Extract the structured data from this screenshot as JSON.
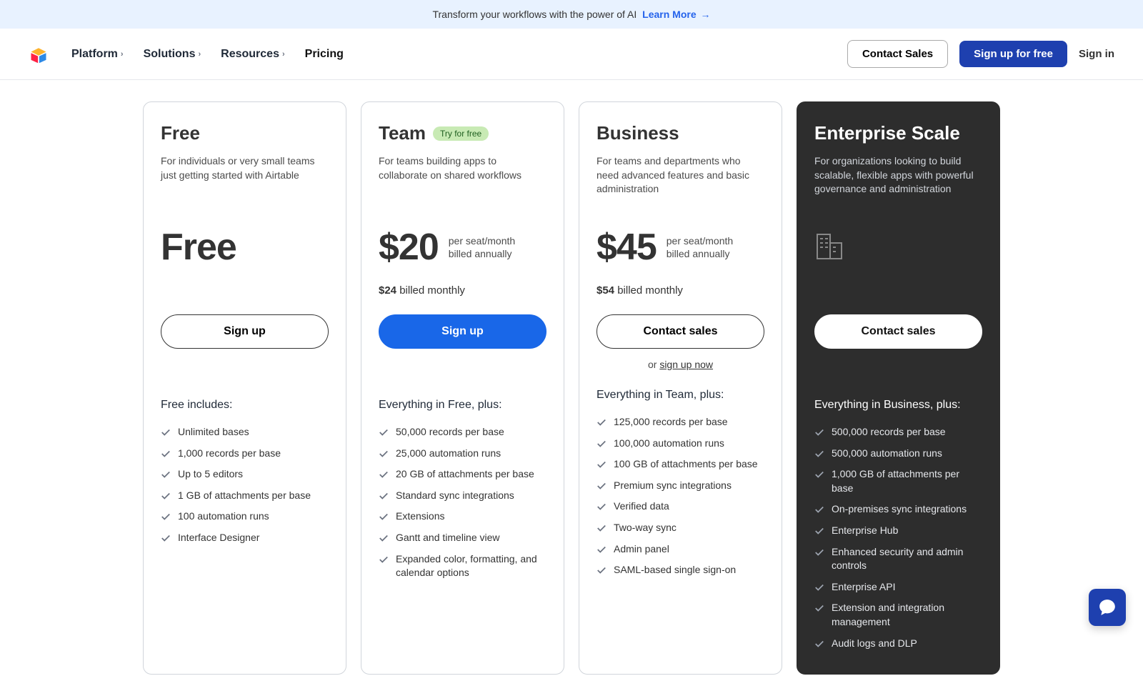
{
  "banner": {
    "text": "Transform your workflows with the power of AI",
    "link": "Learn More"
  },
  "nav": {
    "items": [
      "Platform",
      "Solutions",
      "Resources",
      "Pricing"
    ],
    "contact": "Contact Sales",
    "signup": "Sign up for free",
    "signin": "Sign in"
  },
  "plans": [
    {
      "name": "Free",
      "desc": "For individuals or very small teams just getting started with Airtable",
      "price": "Free",
      "price_sub1": "",
      "price_sub2": "",
      "alt_price": "",
      "alt_price_suffix": "",
      "cta": "Sign up",
      "includes_title": "Free includes:",
      "features": [
        "Unlimited bases",
        "1,000 records per base",
        "Up to 5 editors",
        "1 GB of attachments per base",
        "100 automation runs",
        "Interface Designer"
      ]
    },
    {
      "name": "Team",
      "pill": "Try for free",
      "desc": "For teams building apps to collaborate on shared workflows",
      "price": "$20",
      "price_sub1": "per seat/month",
      "price_sub2": "billed annually",
      "alt_price": "$24",
      "alt_price_suffix": "billed monthly",
      "cta": "Sign up",
      "includes_title": "Everything in Free, plus:",
      "features": [
        "50,000 records per base",
        "25,000 automation runs",
        "20 GB of attachments per base",
        "Standard sync integrations",
        "Extensions",
        "Gantt and timeline view",
        "Expanded color, formatting, and calendar options"
      ]
    },
    {
      "name": "Business",
      "desc": "For teams and departments who need advanced features and basic administration",
      "price": "$45",
      "price_sub1": "per seat/month",
      "price_sub2": "billed annually",
      "alt_price": "$54",
      "alt_price_suffix": "billed monthly",
      "cta": "Contact sales",
      "or_text": "or ",
      "or_link": "sign up now",
      "includes_title": "Everything in Team, plus:",
      "features": [
        "125,000 records per base",
        "100,000 automation runs",
        "100 GB of attachments per base",
        "Premium sync integrations",
        "Verified data",
        "Two-way sync",
        "Admin panel",
        "SAML-based single sign-on"
      ]
    },
    {
      "name": "Enterprise Scale",
      "desc": "For organizations looking to build scalable, flexible apps with powerful governance and administration",
      "cta": "Contact sales",
      "includes_title": "Everything in Business, plus:",
      "features": [
        "500,000 records per base",
        "500,000 automation runs",
        "1,000 GB of attachments per base",
        "On-premises sync integrations",
        "Enterprise Hub",
        "Enhanced security and admin controls",
        "Enterprise API",
        "Extension and integration management",
        "Audit logs and DLP"
      ]
    }
  ]
}
